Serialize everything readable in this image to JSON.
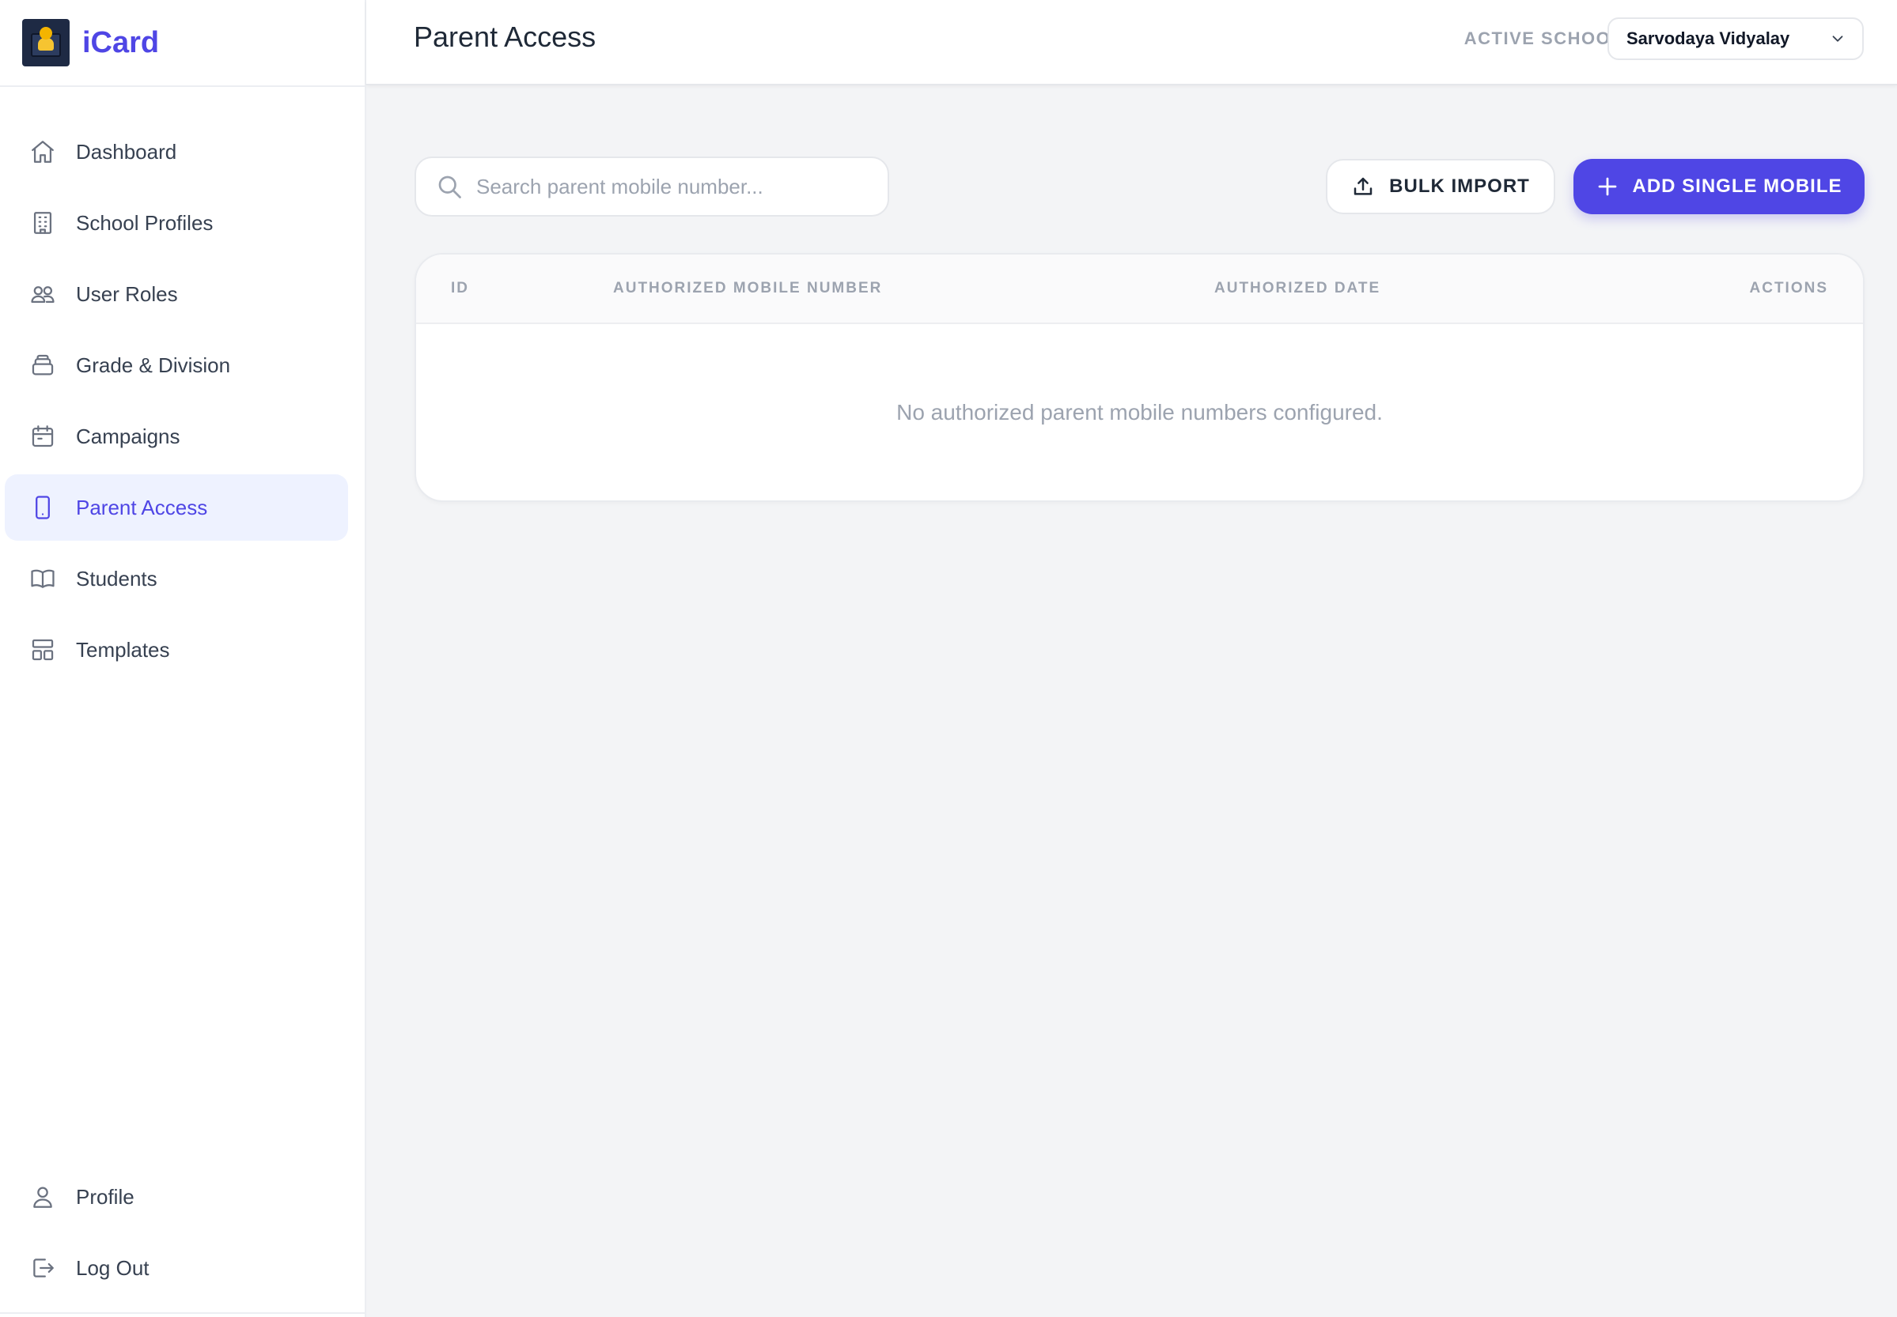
{
  "brand": {
    "name": "iCard"
  },
  "sidebar": {
    "items": [
      {
        "label": "Dashboard",
        "icon": "home-icon"
      },
      {
        "label": "School Profiles",
        "icon": "building-icon"
      },
      {
        "label": "User Roles",
        "icon": "users-icon"
      },
      {
        "label": "Grade & Division",
        "icon": "layers-icon"
      },
      {
        "label": "Campaigns",
        "icon": "calendar-icon"
      },
      {
        "label": "Parent Access",
        "icon": "smartphone-icon",
        "active": true
      },
      {
        "label": "Students",
        "icon": "book-icon"
      },
      {
        "label": "Templates",
        "icon": "layout-icon"
      }
    ],
    "bottom_items": [
      {
        "label": "Profile",
        "icon": "user-icon"
      },
      {
        "label": "Log Out",
        "icon": "logout-icon"
      }
    ]
  },
  "header": {
    "title": "Parent Access",
    "active_school_label": "ACTIVE SCHOOL:",
    "active_school_value": "Sarvodaya Vidyalay"
  },
  "toolbar": {
    "search_placeholder": "Search parent mobile number...",
    "bulk_import_label": "BULK IMPORT",
    "add_single_label": "ADD SINGLE MOBILE"
  },
  "table": {
    "columns": [
      "ID",
      "AUTHORIZED MOBILE NUMBER",
      "AUTHORIZED DATE",
      "ACTIONS"
    ],
    "rows": [],
    "empty_message": "No authorized parent mobile numbers configured."
  },
  "colors": {
    "accent": "#4f46e5",
    "active_bg": "#eef2ff",
    "page_bg": "#f3f4f6",
    "muted_text": "#9ca3af"
  }
}
